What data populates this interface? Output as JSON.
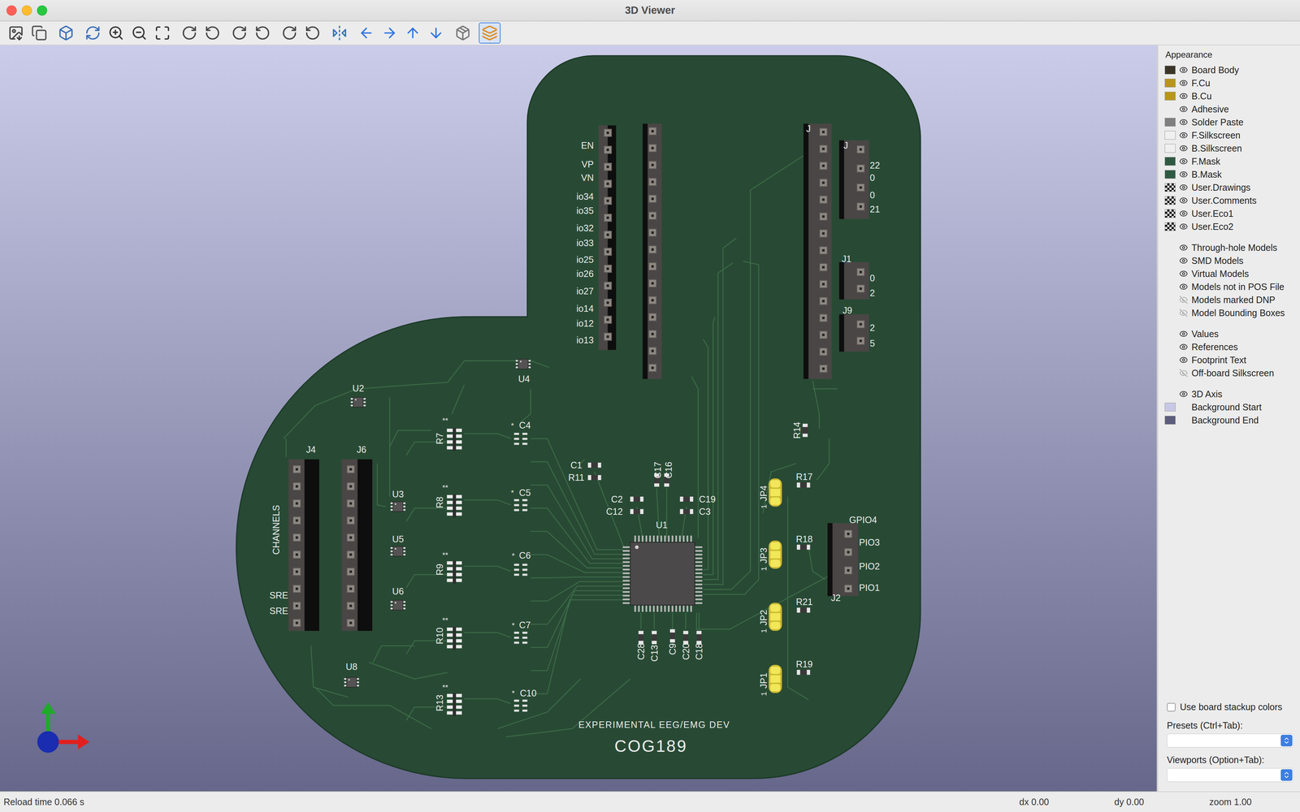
{
  "window": {
    "title": "3D Viewer"
  },
  "toolbar": {
    "groups": [
      [
        {
          "selected": false
        },
        {
          "selected": false
        }
      ],
      [
        {
          "selected": false
        }
      ],
      [
        {
          "selected": false
        },
        {
          "selected": false
        },
        {
          "selected": false
        },
        {
          "selected": false
        }
      ],
      [
        {
          "selected": false
        },
        {
          "selected": false
        }
      ],
      [
        {
          "selected": false
        },
        {
          "selected": false
        }
      ],
      [
        {
          "selected": false
        },
        {
          "selected": false
        }
      ],
      [
        {
          "selected": false
        }
      ],
      [
        {
          "selected": false
        },
        {
          "selected": false
        },
        {
          "selected": false
        },
        {
          "selected": false
        }
      ],
      [
        {
          "selected": false
        }
      ],
      [
        {
          "selected": true
        }
      ]
    ]
  },
  "board": {
    "headerLabels": [
      "EN",
      "VP",
      "VN",
      "io34",
      "io35",
      "io32",
      "io33",
      "io25",
      "io26",
      "io27",
      "io14",
      "io12",
      "io13"
    ],
    "references": [
      "U2",
      "J4",
      "J6",
      "U3",
      "U5",
      "U6",
      "U8",
      "U4",
      "R7",
      "R8",
      "R9",
      "R10",
      "R13",
      "C4",
      "C5",
      "C6",
      "C7",
      "C10",
      "C1",
      "R11",
      "C2",
      "C12",
      "C19",
      "C3",
      "C17",
      "C16",
      "U1",
      "R17",
      "R18",
      "R21",
      "R19",
      "JP4",
      "JP3",
      "JP2",
      "JP1",
      "R14",
      "J1",
      "J9",
      "J2",
      "C28",
      "C13",
      "C9",
      "C20",
      "C18",
      "J",
      "J"
    ],
    "connectorLabels": {
      "j7": [
        "22",
        "0",
        "0",
        "21"
      ],
      "j1": [
        "0",
        "2"
      ],
      "j9": [
        "2",
        "5"
      ],
      "j2": [
        "GPIO4",
        "PIO3",
        "PIO2",
        "PIO1"
      ]
    },
    "sideLabels": [
      "CHANNELS",
      "SRE",
      "SRE"
    ],
    "stars": [
      "**",
      "**",
      "**",
      "**",
      "**",
      "*",
      "*",
      "*",
      "*",
      "*"
    ],
    "jumperMarks": [
      "1",
      "1",
      "1",
      "1"
    ],
    "title": "EXPERIMENTAL EEG/EMG DEV",
    "subtitle": "COG189"
  },
  "appearance": {
    "title": "Appearance",
    "groups": [
      [
        {
          "label": "Board Body",
          "kind": "solid",
          "color": "#3b3528",
          "visible": true
        },
        {
          "label": "F.Cu",
          "kind": "solid",
          "color": "#b8961c",
          "visible": true
        },
        {
          "label": "B.Cu",
          "kind": "solid",
          "color": "#b8961c",
          "visible": true
        },
        {
          "label": "Adhesive",
          "kind": "none",
          "visible": true
        },
        {
          "label": "Solder Paste",
          "kind": "solid",
          "color": "#808080",
          "visible": true
        },
        {
          "label": "F.Silkscreen",
          "kind": "solid",
          "color": "#f0f0f0",
          "visible": true
        },
        {
          "label": "B.Silkscreen",
          "kind": "solid",
          "color": "#f0f0f0",
          "visible": true
        },
        {
          "label": "F.Mask",
          "kind": "solid",
          "color": "#2f5a42",
          "visible": true
        },
        {
          "label": "B.Mask",
          "kind": "solid",
          "color": "#2f5a42",
          "visible": true
        },
        {
          "label": "User.Drawings",
          "kind": "checker",
          "visible": true
        },
        {
          "label": "User.Comments",
          "kind": "checker",
          "visible": true
        },
        {
          "label": "User.Eco1",
          "kind": "checker",
          "visible": true
        },
        {
          "label": "User.Eco2",
          "kind": "checker",
          "visible": true
        }
      ],
      [
        {
          "label": "Through-hole Models",
          "kind": "none",
          "visible": true
        },
        {
          "label": "SMD Models",
          "kind": "none",
          "visible": true
        },
        {
          "label": "Virtual Models",
          "kind": "none",
          "visible": true
        },
        {
          "label": "Models not in POS File",
          "kind": "none",
          "visible": true
        },
        {
          "label": "Models marked DNP",
          "kind": "none",
          "visible": false
        },
        {
          "label": "Model Bounding Boxes",
          "kind": "none",
          "visible": false
        }
      ],
      [
        {
          "label": "Values",
          "kind": "none",
          "visible": true
        },
        {
          "label": "References",
          "kind": "none",
          "visible": true
        },
        {
          "label": "Footprint Text",
          "kind": "none",
          "visible": true
        },
        {
          "label": "Off-board Silkscreen",
          "kind": "none",
          "visible": false
        }
      ],
      [
        {
          "label": "3D Axis",
          "kind": "none",
          "visible": true
        },
        {
          "label": "Background Start",
          "kind": "background",
          "color": "#c8c8e6"
        },
        {
          "label": "Background End",
          "kind": "background",
          "color": "#5c5c7c"
        }
      ]
    ],
    "checkbox": {
      "label": "Use board stackup colors",
      "checked": false
    },
    "presets": {
      "label": "Presets (Ctrl+Tab):",
      "value": ""
    },
    "viewports": {
      "label": "Viewports (Option+Tab):",
      "value": ""
    }
  },
  "status_bar": {
    "left": "Reload time 0.066 s",
    "cells": [
      "dx 0.00",
      "dy 0.00",
      "zoom 1.00"
    ]
  }
}
